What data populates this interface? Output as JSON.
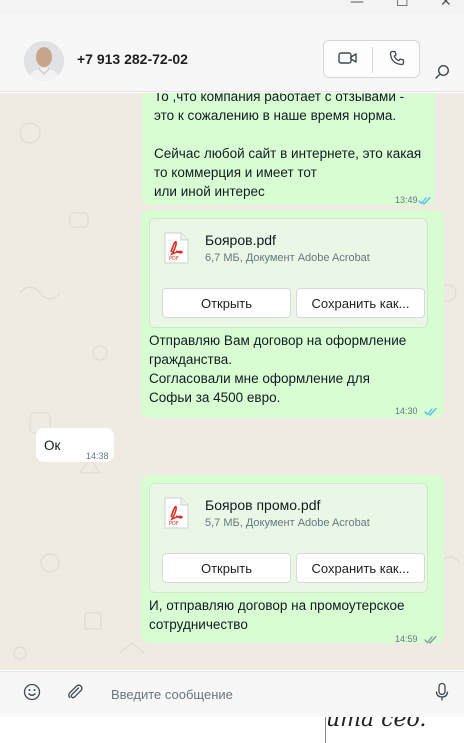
{
  "titlebar": {
    "minimize": "—",
    "maximize": "☐",
    "close": "✕"
  },
  "header": {
    "contact_name": "+7 913 282-72-02",
    "icons": {
      "video": "video-camera-icon",
      "call": "phone-icon",
      "search": "search-icon"
    }
  },
  "messages": {
    "m1": {
      "text": "То ,что компания работает с отзывами -\nэто к сожалению в наше время норма.\n\nСейчас любой сайт в интернете, это какая\nто коммерция  и имеет тот\nили иной интерес",
      "time": "13:49",
      "status": "read"
    },
    "m2": {
      "file_name": "Бояров.pdf",
      "file_meta": "6,7 МБ, Документ Adobe Acrobat",
      "open_label": "Открыть",
      "save_label": "Сохранить как...",
      "text": "Отправляю Вам договор на оформление\nгражданства.\nСогласовали мне оформление для\nСофьи за 4500 евро.",
      "time": "14:30",
      "status": "read"
    },
    "m3": {
      "text": "Ок",
      "time": "14:38"
    },
    "m4": {
      "file_name": "Бояров промо.pdf",
      "file_meta": "5,7 МБ, Документ Adobe Acrobat",
      "open_label": "Открыть",
      "save_label": "Сохранить как...",
      "text": "И, отправляю договор на промоутерское\nсотрудничество",
      "time": "14:59",
      "status": "delivered"
    }
  },
  "composer": {
    "placeholder": "Введите сообщение",
    "icons": {
      "emoji": "emoji-icon",
      "attach": "paperclip-icon",
      "mic": "microphone-icon"
    }
  },
  "background_fragment": {
    "text": "uma ceo."
  },
  "colors": {
    "outgoing_bubble": "#d9fdd3",
    "incoming_bubble": "#ffffff",
    "chat_background": "#efeae2",
    "read_ticks": "#53bdeb",
    "pdf_red": "#d93025"
  }
}
